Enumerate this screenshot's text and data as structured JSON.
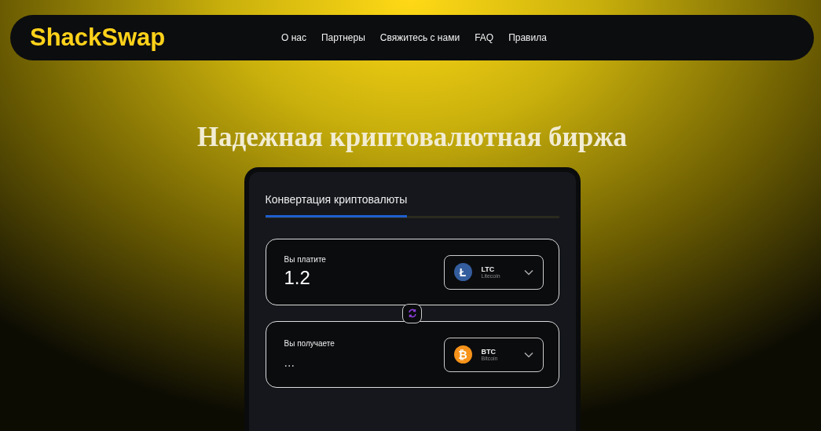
{
  "logo": "ShackSwap",
  "nav": [
    "О нас",
    "Партнеры",
    "Свяжитесь с нами",
    "FAQ",
    "Правила"
  ],
  "heading": "Надежная криптовалютная биржа",
  "tabs": [
    {
      "label": "Конвертация криптовалюты",
      "selected": true
    }
  ],
  "fields": [
    {
      "label": "Вы платите",
      "value": "1.2",
      "coin": {
        "ticker": "LTC",
        "name": "Litecoin",
        "symbol": "Ł",
        "color": "#345d9d"
      }
    },
    {
      "label": "Вы получаете",
      "value": "...",
      "coin": {
        "ticker": "BTC",
        "name": "Bitcoin",
        "symbol": "₿",
        "color": "#f7931a"
      }
    }
  ]
}
